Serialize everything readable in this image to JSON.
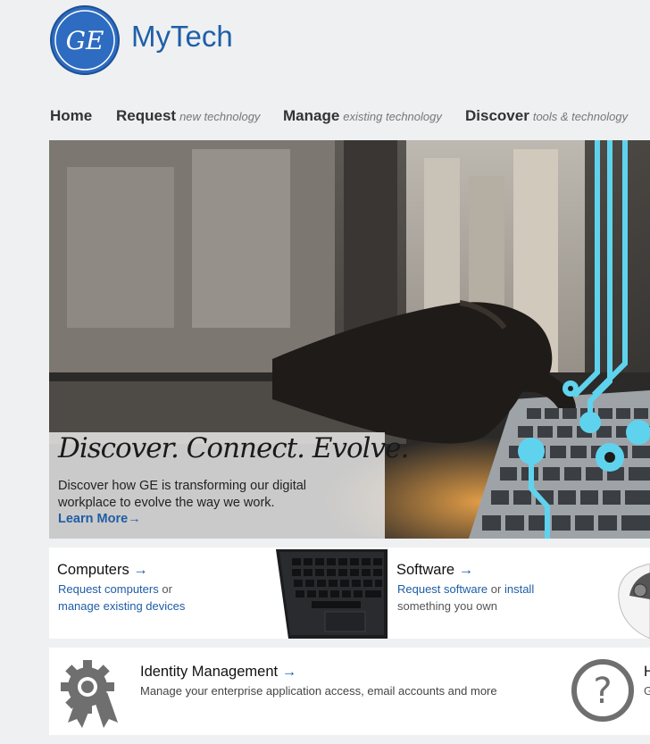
{
  "app": {
    "title": "MyTech",
    "logo_text": "GE"
  },
  "nav": {
    "home": "Home",
    "request": {
      "label": "Request",
      "sub": "new technology"
    },
    "manage": {
      "label": "Manage",
      "sub": "existing technology"
    },
    "discover": {
      "label": "Discover",
      "sub": "tools & technology"
    }
  },
  "hero": {
    "title": "Discover. Connect. Evolve.",
    "description": "Discover how GE is transforming our digital workplace to evolve the way we work.",
    "link": "Learn More",
    "arrow": "→"
  },
  "cards": {
    "computers": {
      "title": "Computers",
      "arrow": "→",
      "link1": "Request computers",
      "or": " or",
      "link2": "manage existing devices"
    },
    "software": {
      "title": "Software",
      "arrow": "→",
      "link1": "Request software",
      "or": " or ",
      "link2": "install",
      "line2": "something you own"
    },
    "identity": {
      "title": "Identity Management",
      "arrow": "→",
      "desc": "Manage your enterprise application access, email accounts and more"
    },
    "help": {
      "title": "H",
      "desc": "G"
    }
  },
  "colors": {
    "brand": "#1f5fa8",
    "link": "#1e5da5",
    "circuit": "#5fd3ee"
  },
  "icons": [
    "ge-logo-icon",
    "arrow-right-icon",
    "laptop-image",
    "mouse-image",
    "gear-badge-icon",
    "question-icon"
  ]
}
